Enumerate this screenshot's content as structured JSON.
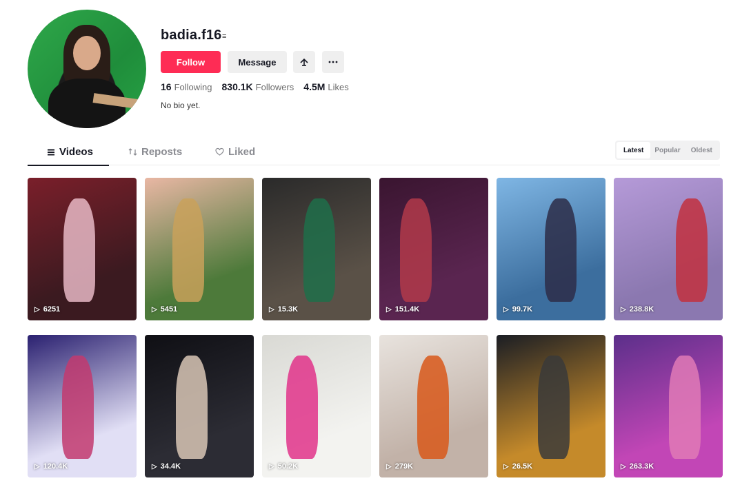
{
  "profile": {
    "username": "badia.f16",
    "verified_mark": "≡",
    "bio": "No bio yet."
  },
  "actions": {
    "follow_label": "Follow",
    "message_label": "Message",
    "friend_icon": "add-friend-icon",
    "more_icon": "more-icon"
  },
  "stats": {
    "following_count": "16",
    "following_label": "Following",
    "followers_count": "830.1K",
    "followers_label": "Followers",
    "likes_count": "4.5M",
    "likes_label": "Likes"
  },
  "tabs": [
    {
      "label": "Videos",
      "icon": "grid-icon"
    },
    {
      "label": "Reposts",
      "icon": "repost-icon"
    },
    {
      "label": "Liked",
      "icon": "heart-outline-icon"
    }
  ],
  "sort": {
    "options": [
      "Latest",
      "Popular",
      "Oldest"
    ],
    "selected": "Latest"
  },
  "videos": [
    {
      "views": "6251",
      "colors": [
        "#7a1f2a",
        "#3b1a20",
        "#e7b9c5"
      ]
    },
    {
      "views": "5451",
      "colors": [
        "#e9b7a4",
        "#4d7a3a",
        "#c9a15a"
      ]
    },
    {
      "views": "15.3K",
      "colors": [
        "#2a2a2a",
        "#5a5147",
        "#1f6e4a"
      ]
    },
    {
      "views": "151.4K",
      "colors": [
        "#3a1530",
        "#5a2550",
        "#b23a4a"
      ]
    },
    {
      "views": "99.7K",
      "colors": [
        "#7fb6e4",
        "#3c6e9e",
        "#2d2d48"
      ]
    },
    {
      "views": "238.8K",
      "colors": [
        "#b59ad8",
        "#8b78b0",
        "#c2303e"
      ]
    },
    {
      "views": "120.4K",
      "colors": [
        "#2a2070",
        "#e1dff5",
        "#c23a6e"
      ]
    },
    {
      "views": "34.4K",
      "colors": [
        "#0f0f14",
        "#2c2c34",
        "#d9c7b6"
      ]
    },
    {
      "views": "50.2K",
      "colors": [
        "#d9d9d4",
        "#f3f3f0",
        "#e0338a"
      ]
    },
    {
      "views": "279K",
      "colors": [
        "#e8e3de",
        "#c2b2a8",
        "#d8581a"
      ]
    },
    {
      "views": "26.5K",
      "colors": [
        "#1a1d24",
        "#c58a2a",
        "#3a3a3a"
      ]
    },
    {
      "views": "263.3K",
      "colors": [
        "#5b2f8a",
        "#c246b6",
        "#e07ab6"
      ]
    }
  ]
}
